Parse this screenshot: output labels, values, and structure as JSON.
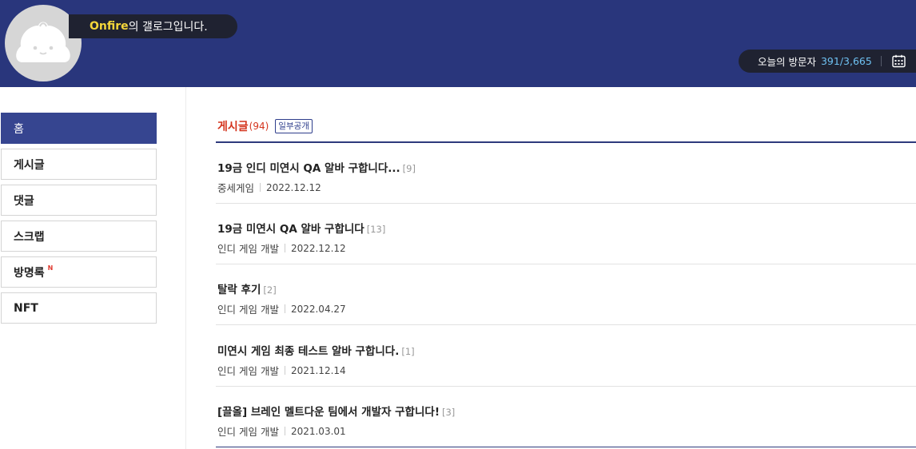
{
  "header": {
    "nickname": "Onfire",
    "greeting_suffix": "의 갤로그입니다.",
    "visitor_label": "오늘의 방문자",
    "visitor_count": "391/3,665",
    "colors": {
      "background": "#29367c",
      "pill": "#1f2231",
      "nickname": "#f4d63a",
      "count": "#6ec1f2"
    },
    "icons": {
      "avatar": "bun-mascot-avatar",
      "calendar": "calendar-icon"
    }
  },
  "sidebar": {
    "items": [
      {
        "label": "홈",
        "active": true
      },
      {
        "label": "게시글"
      },
      {
        "label": "댓글"
      },
      {
        "label": "스크랩"
      },
      {
        "label": "방명록",
        "badge": "N"
      },
      {
        "label": "NFT"
      }
    ]
  },
  "posts_section": {
    "title": "게시글",
    "count": "(94)",
    "visibility": "일부공개",
    "accent_color": "#d4341d"
  },
  "posts": [
    {
      "title": "19금 인디 미연시 QA 알바 구합니다...",
      "comments": "[9]",
      "category": "중세게임",
      "date": "2022.12.12"
    },
    {
      "title": "19금 미연시 QA 알바 구합니다",
      "comments": "[13]",
      "category": "인디 게임 개발",
      "date": "2022.12.12"
    },
    {
      "title": "탈락 후기",
      "comments": "[2]",
      "category": "인디 게임 개발",
      "date": "2022.04.27"
    },
    {
      "title": "미연시 게임 최종 테스트 알바 구합니다.",
      "comments": "[1]",
      "category": "인디 게임 개발",
      "date": "2021.12.14"
    },
    {
      "title": "[끌올] 브레인 멜트다운 팀에서 개발자 구합니다!",
      "comments": "[3]",
      "category": "인디 게임 개발",
      "date": "2021.03.01"
    }
  ]
}
